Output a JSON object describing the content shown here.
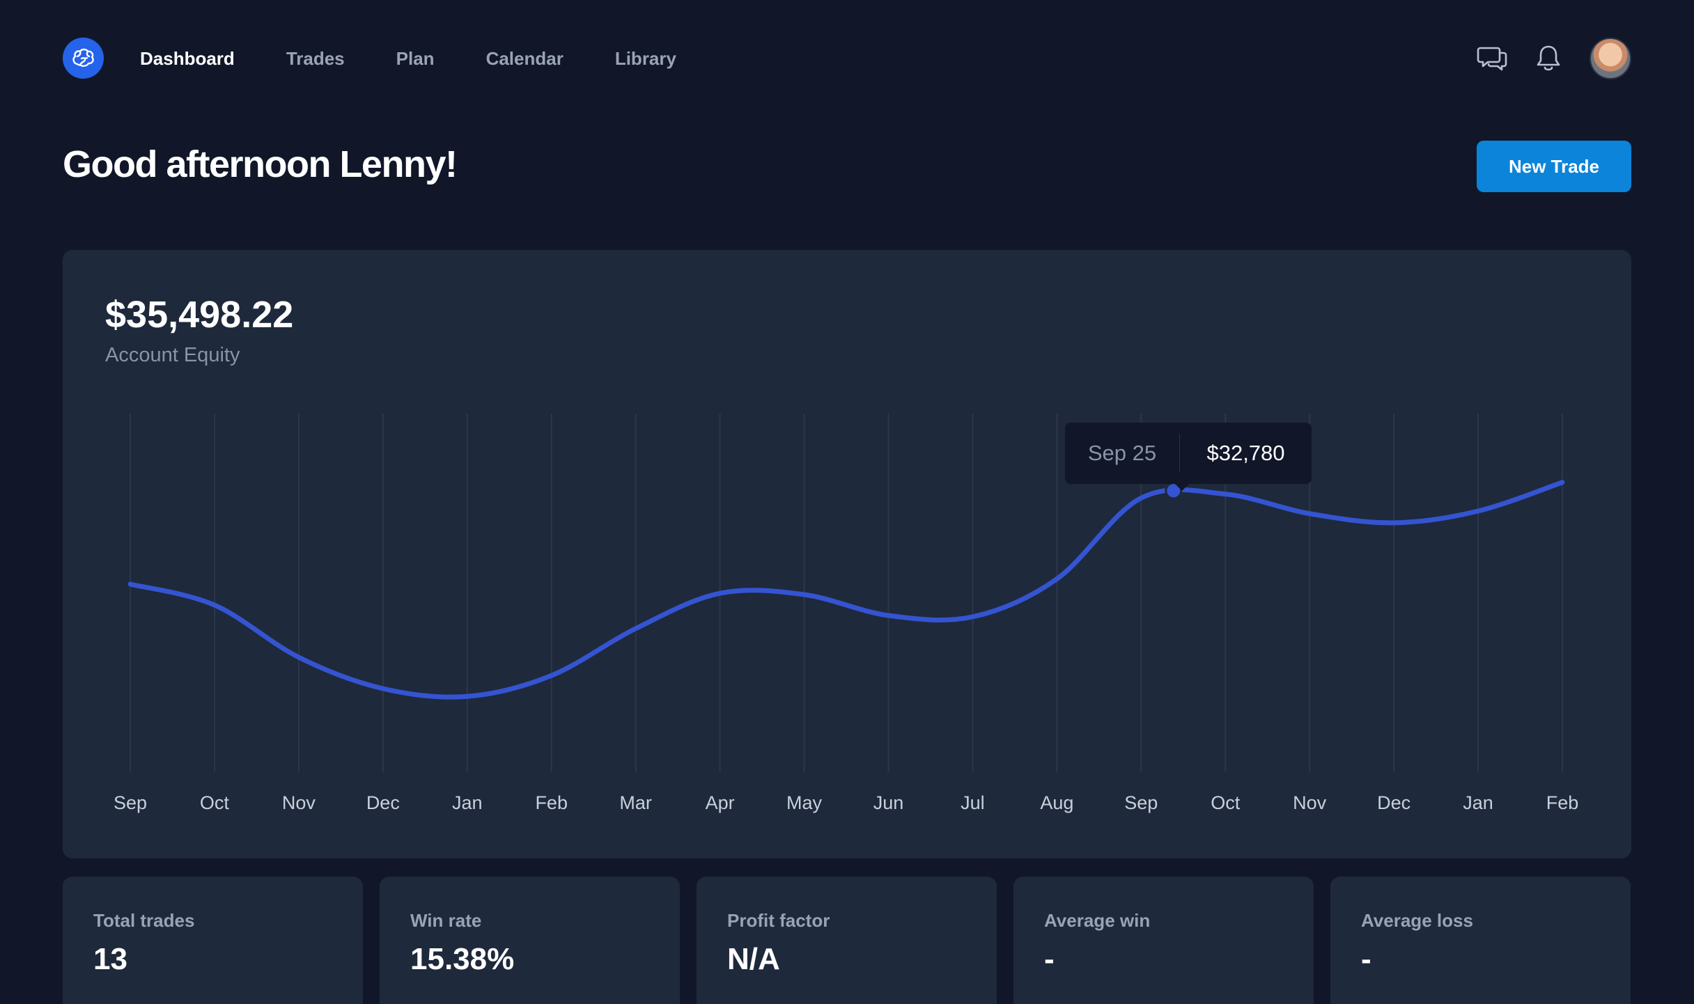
{
  "nav": {
    "logo_icon": "brain-icon",
    "links": [
      {
        "label": "Dashboard",
        "active": true
      },
      {
        "label": "Trades",
        "active": false
      },
      {
        "label": "Plan",
        "active": false
      },
      {
        "label": "Calendar",
        "active": false
      },
      {
        "label": "Library",
        "active": false
      }
    ],
    "right_icons": [
      "chat-icon",
      "bell-icon"
    ]
  },
  "header": {
    "greeting": "Good afternoon Lenny!",
    "new_trade_label": "New Trade"
  },
  "equity": {
    "value": "$35,498.22",
    "label": "Account Equity",
    "tooltip": {
      "date": "Sep 25",
      "value": "$32,780"
    }
  },
  "chart_data": {
    "type": "line",
    "x": [
      "Sep",
      "Oct",
      "Nov",
      "Dec",
      "Jan",
      "Feb",
      "Mar",
      "Apr",
      "May",
      "Jun",
      "Jul",
      "Aug",
      "Sep",
      "Oct",
      "Nov",
      "Dec",
      "Jan",
      "Feb"
    ],
    "series": [
      {
        "values": [
          29200,
          28400,
          26400,
          25200,
          24900,
          25700,
          27500,
          28850,
          28800,
          28000,
          27950,
          29400,
          32500,
          32650,
          31900,
          31550,
          32000,
          33100
        ]
      }
    ],
    "highlight": {
      "label": "Sep 25",
      "value": 32780
    },
    "grid": "vertical",
    "line_color": "#3454d1"
  },
  "stats": [
    {
      "label": "Total trades",
      "value": "13"
    },
    {
      "label": "Win rate",
      "value": "15.38%"
    },
    {
      "label": "Profit factor",
      "value": "N/A"
    },
    {
      "label": "Average win",
      "value": "-"
    },
    {
      "label": "Average loss",
      "value": "-"
    }
  ]
}
